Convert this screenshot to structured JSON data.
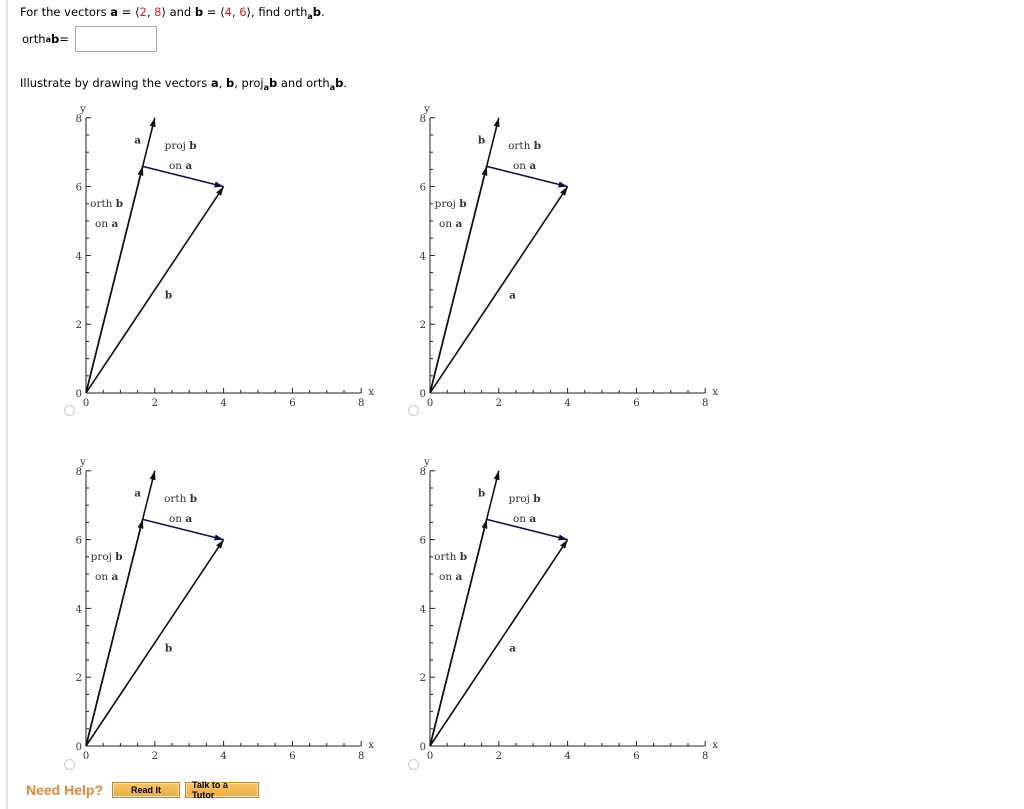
{
  "question": {
    "prefix": "For the vectors ",
    "a_label": "a",
    "eq1": " = ⟨",
    "a_x": "2",
    "comma": ", ",
    "a_y": "8",
    "close_and": "⟩ and ",
    "b_label": "b",
    "eq2": " = ⟨",
    "b_x": "4",
    "b_y": "6",
    "close_find": "⟩,  find orth",
    "sub_a": "a",
    "end_b": "b",
    "period": "."
  },
  "answer": {
    "label_prefix": "orth",
    "label_sub": "a",
    "label_b": "b",
    "label_eq": " =",
    "value": "",
    "placeholder": ""
  },
  "illustrate": {
    "text1": "Illustrate by drawing the vectors ",
    "a": "a",
    "sep1": ", ",
    "b": "b",
    "sep2": ", proj",
    "sub1": "a",
    "b2": "b",
    "text2": " and orth",
    "sub2": "a",
    "b3": "b",
    "end": "."
  },
  "colors": {
    "accent_red": "#dd2222",
    "help_orange": "#e2883a",
    "button_fill": "#f4b04a"
  },
  "vectors": {
    "a": [
      2,
      8
    ],
    "b": [
      4,
      6
    ],
    "proj": [
      1.6471,
      6.5882
    ],
    "orth_from": [
      1.6471,
      6.5882
    ],
    "orth_to": [
      4,
      6
    ]
  },
  "axes": {
    "xlabel": "x",
    "ylabel": "y",
    "xticks": [
      "0",
      "2",
      "4",
      "6",
      "8"
    ],
    "yticks": [
      "0",
      "2",
      "4",
      "6",
      "8"
    ],
    "xlim": [
      0,
      8
    ],
    "ylim": [
      0,
      8
    ]
  },
  "chart_data": [
    {
      "type": "line",
      "option": 1,
      "long_vector_label": "a",
      "diag_vector_label": "b",
      "upper_label": [
        "proj b",
        "on a"
      ],
      "left_label": [
        "orth b",
        "on a"
      ],
      "xlim": [
        0,
        8
      ],
      "ylim": [
        0,
        8
      ]
    },
    {
      "type": "line",
      "option": 2,
      "long_vector_label": "b",
      "diag_vector_label": "a",
      "upper_label": [
        "orth b",
        "on a"
      ],
      "left_label": [
        "proj b",
        "on a"
      ],
      "xlim": [
        0,
        8
      ],
      "ylim": [
        0,
        8
      ]
    },
    {
      "type": "line",
      "option": 3,
      "long_vector_label": "a",
      "diag_vector_label": "b",
      "upper_label": [
        "orth b",
        "on a"
      ],
      "left_label": [
        "proj b",
        "on a"
      ],
      "xlim": [
        0,
        8
      ],
      "ylim": [
        0,
        8
      ]
    },
    {
      "type": "line",
      "option": 4,
      "long_vector_label": "b",
      "diag_vector_label": "a",
      "upper_label": [
        "proj b",
        "on a"
      ],
      "left_label": [
        "orth b",
        "on a"
      ],
      "xlim": [
        0,
        8
      ],
      "ylim": [
        0,
        8
      ]
    }
  ],
  "help": {
    "label": "Need Help?",
    "read_it": "Read It",
    "tutor": "Talk to a Tutor"
  }
}
